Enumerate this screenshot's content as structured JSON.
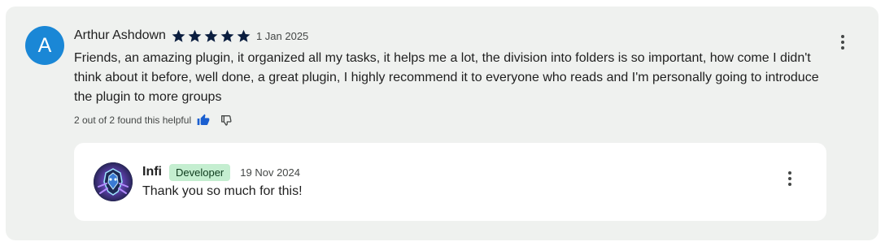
{
  "review": {
    "avatar_letter": "A",
    "author": "Arthur Ashdown",
    "rating": 5,
    "rating_max": 5,
    "date": "1 Jan 2025",
    "text": "Friends, an amazing plugin, it organized all my tasks, it helps me a lot, the division into folders is so important, how come I didn't think about it before, well done, a great plugin, I highly recommend it to everyone who reads and I'm personally going to introduce the plugin to more groups",
    "helpful_text": "2 out of 2 found this helpful",
    "thumb_up_icon": "thumb-up-filled",
    "thumb_down_icon": "thumb-down-outline",
    "menu_icon": "more-vert"
  },
  "reply": {
    "author": "Infi",
    "badge": "Developer",
    "date": "19 Nov 2024",
    "text": "Thank you so much for this!",
    "menu_icon": "more-vert"
  },
  "colors": {
    "card_bg": "#eff1ef",
    "avatar_bg": "#1a87d6",
    "star": "#0b1e3f",
    "badge_bg": "#c4eed0",
    "thumb_up": "#1a5fd0"
  }
}
